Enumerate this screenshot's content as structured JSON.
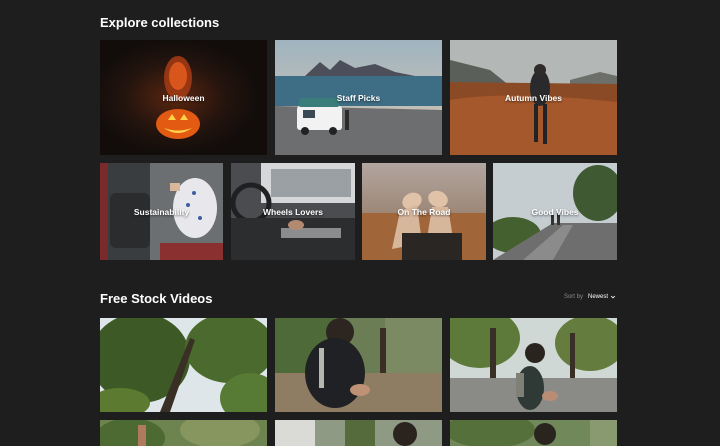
{
  "collections": {
    "title": "Explore collections",
    "items": [
      {
        "label": "Halloween"
      },
      {
        "label": "Staff Picks"
      },
      {
        "label": "Autumn Vibes"
      },
      {
        "label": "Sustainability"
      },
      {
        "label": "Wheels Lovers"
      },
      {
        "label": "On The Road"
      },
      {
        "label": "Good Vibes"
      }
    ]
  },
  "stock": {
    "title": "Free Stock Videos",
    "sort_label": "Sort by",
    "sort_value": "Newest",
    "chevron_icon": "chevron-down-icon"
  },
  "colors": {
    "background": "#1e1e1f",
    "text": "#ffffff",
    "muted": "#8a8a8a"
  }
}
